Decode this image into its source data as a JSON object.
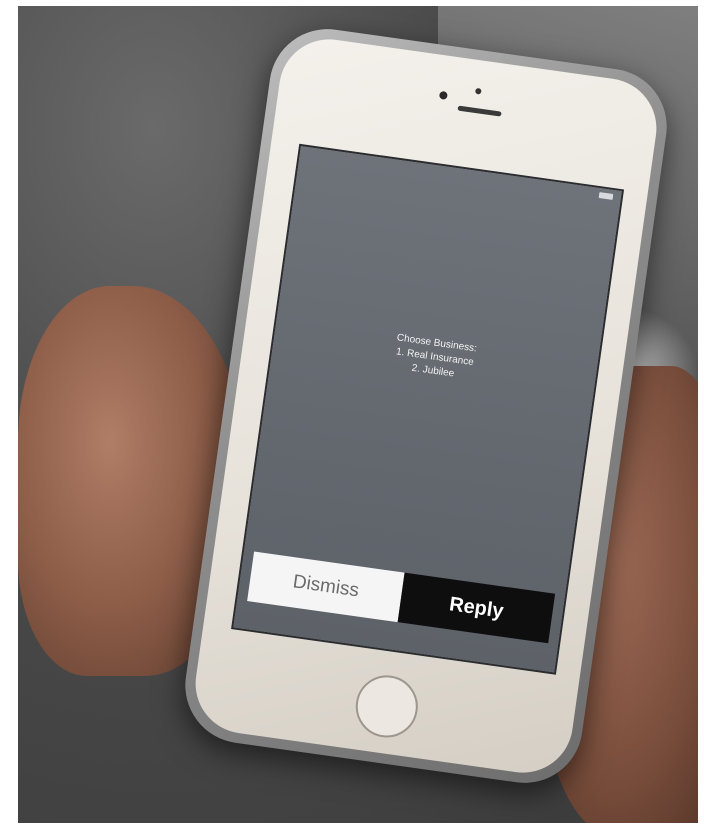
{
  "notification": {
    "title": "Choose Business:",
    "line1": "1. Real Insurance",
    "line2": "2. Jubilee"
  },
  "actions": {
    "dismiss_label": "Dismiss",
    "reply_label": "Reply"
  },
  "colors": {
    "screen_bg": "#65696f",
    "dismiss_bg": "#f5f5f5",
    "reply_bg": "#0e0e0f",
    "phone_body": "#ebe7e0"
  },
  "icons": [
    "battery-icon",
    "camera-icon",
    "speaker-icon",
    "home-button"
  ]
}
